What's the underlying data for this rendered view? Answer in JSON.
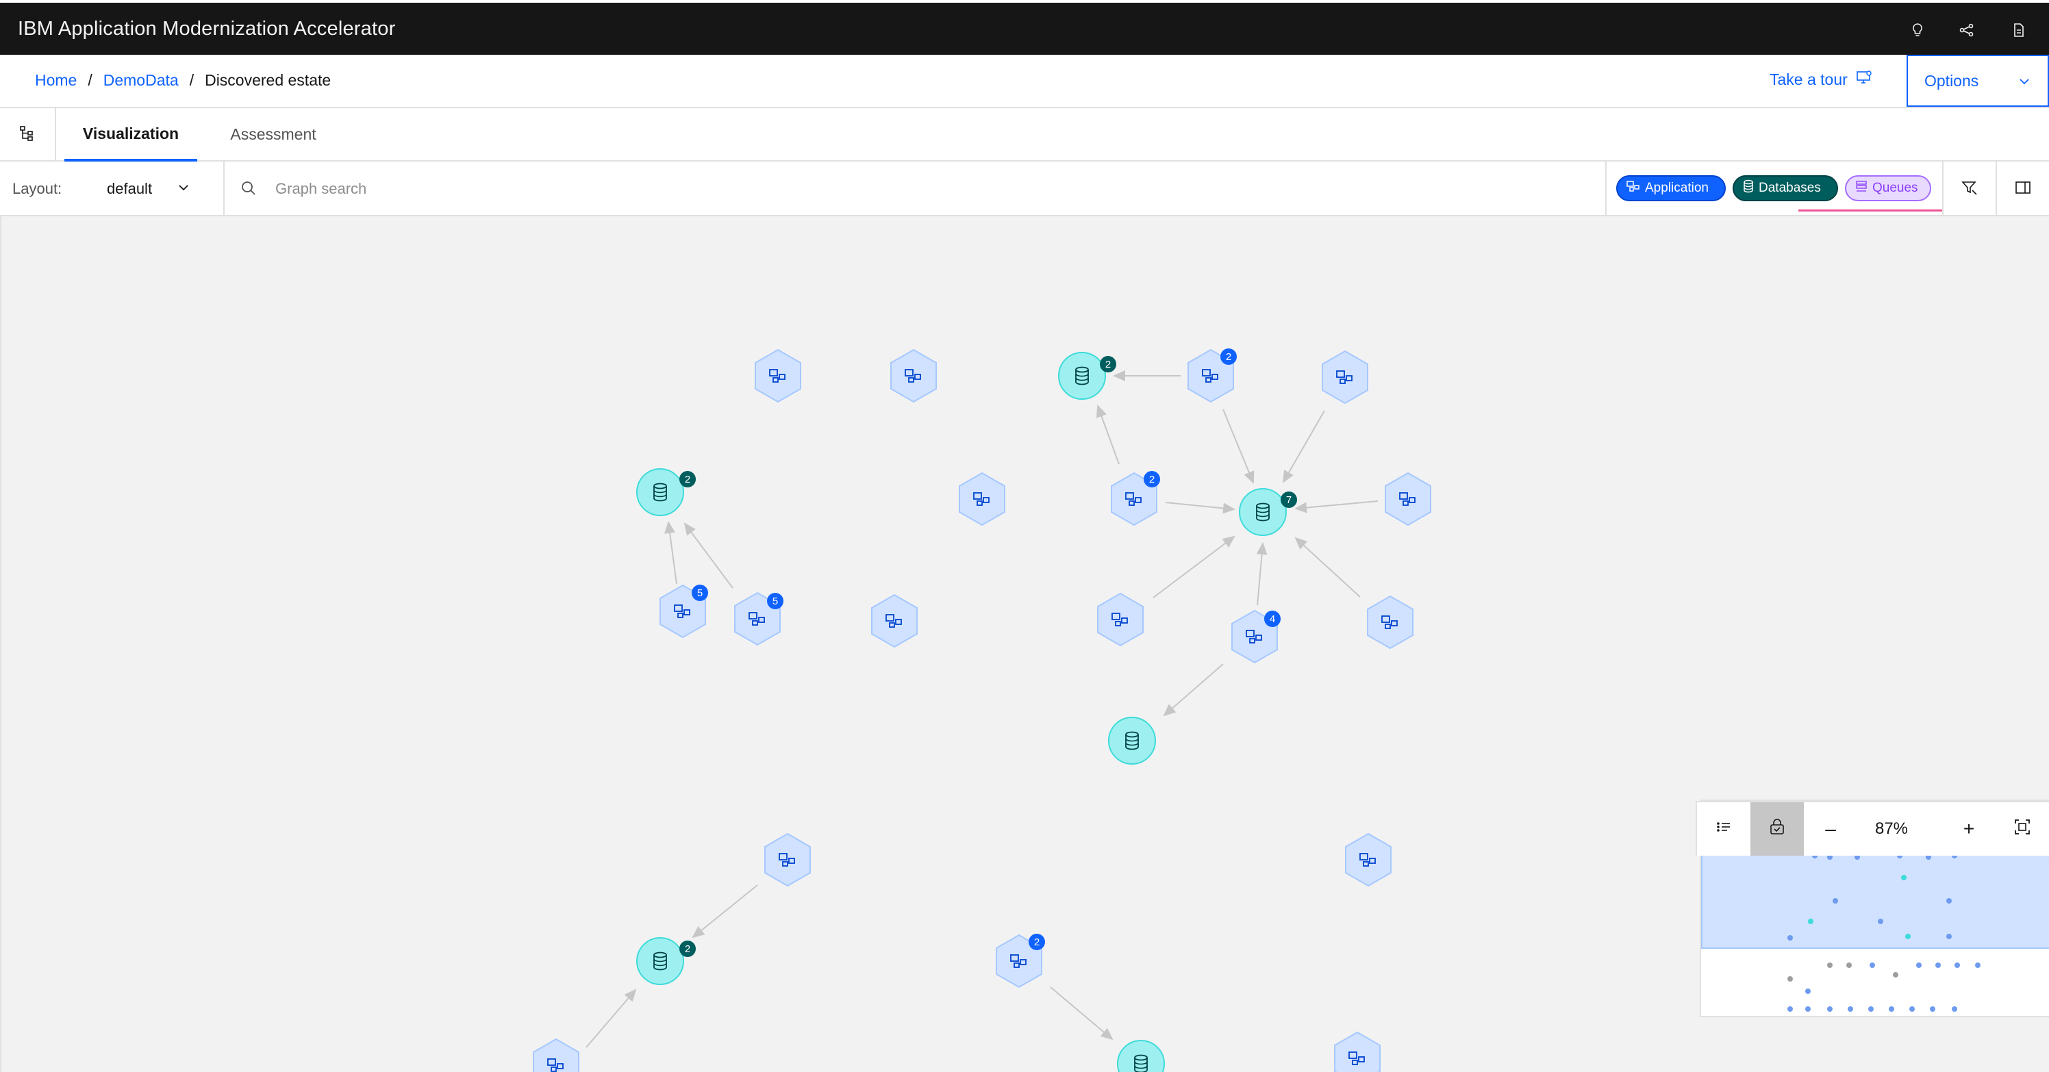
{
  "header": {
    "title": "IBM Application Modernization Accelerator",
    "icons": [
      "lightbulb-icon",
      "share-icon",
      "document-icon"
    ]
  },
  "breadcrumb": {
    "items": [
      "Home",
      "DemoData",
      "Discovered estate"
    ]
  },
  "actions": {
    "tour_label": "Take a tour",
    "options_label": "Options"
  },
  "tabs": {
    "visualization": "Visualization",
    "assessment": "Assessment"
  },
  "toolbar": {
    "layout_label": "Layout:",
    "layout_value": "default",
    "search_placeholder": "Graph search",
    "chips": {
      "application": "Application",
      "databases": "Databases",
      "queues": "Queues"
    }
  },
  "graph": {
    "badges": [
      "2",
      "2",
      "2",
      "2",
      "7",
      "5",
      "5",
      "4",
      "2",
      "2"
    ]
  },
  "zoom": {
    "level": "87%",
    "minus": "–",
    "plus": "+"
  },
  "colors": {
    "header_bg": "#161616",
    "accent": "#0f62fe",
    "app_node": "#d0e2ff",
    "db_node": "#9ef0f0",
    "db_badge": "#005d5d",
    "queue_chip": "#e8daff"
  }
}
